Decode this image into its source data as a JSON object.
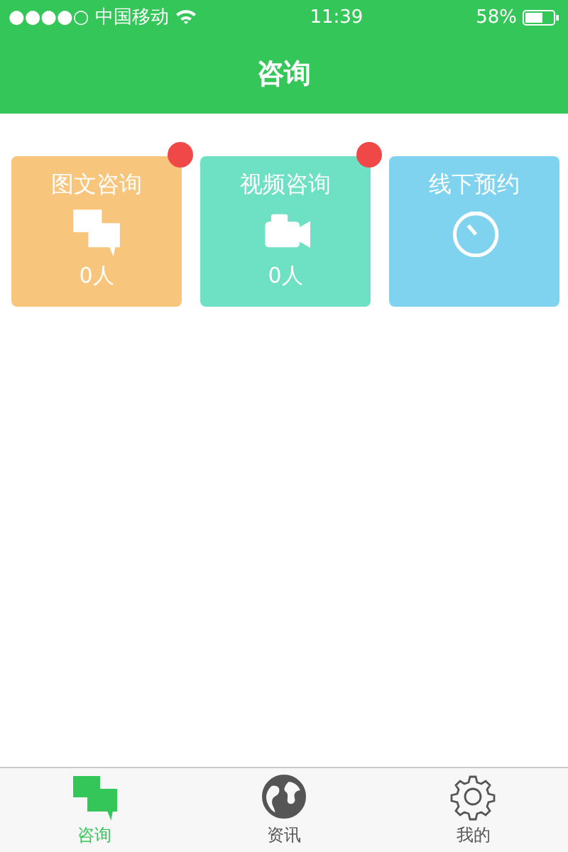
{
  "status_bar": {
    "carrier": "●●●●○ 中国移动",
    "time": "11:39",
    "battery": "58%"
  },
  "header": {
    "title": "咨询"
  },
  "cards": [
    {
      "label": "图文咨询",
      "count": "0人",
      "badge": true,
      "color": "#f7c67c"
    },
    {
      "label": "视频咨询",
      "count": "0人",
      "badge": true,
      "color": "#6ee0c3"
    },
    {
      "label": "线下预约",
      "badge": false,
      "color": "#80d3ee"
    }
  ],
  "tabs": [
    {
      "label": "咨询",
      "selected": true
    },
    {
      "label": "资讯",
      "selected": false
    },
    {
      "label": "我的",
      "selected": false
    }
  ]
}
